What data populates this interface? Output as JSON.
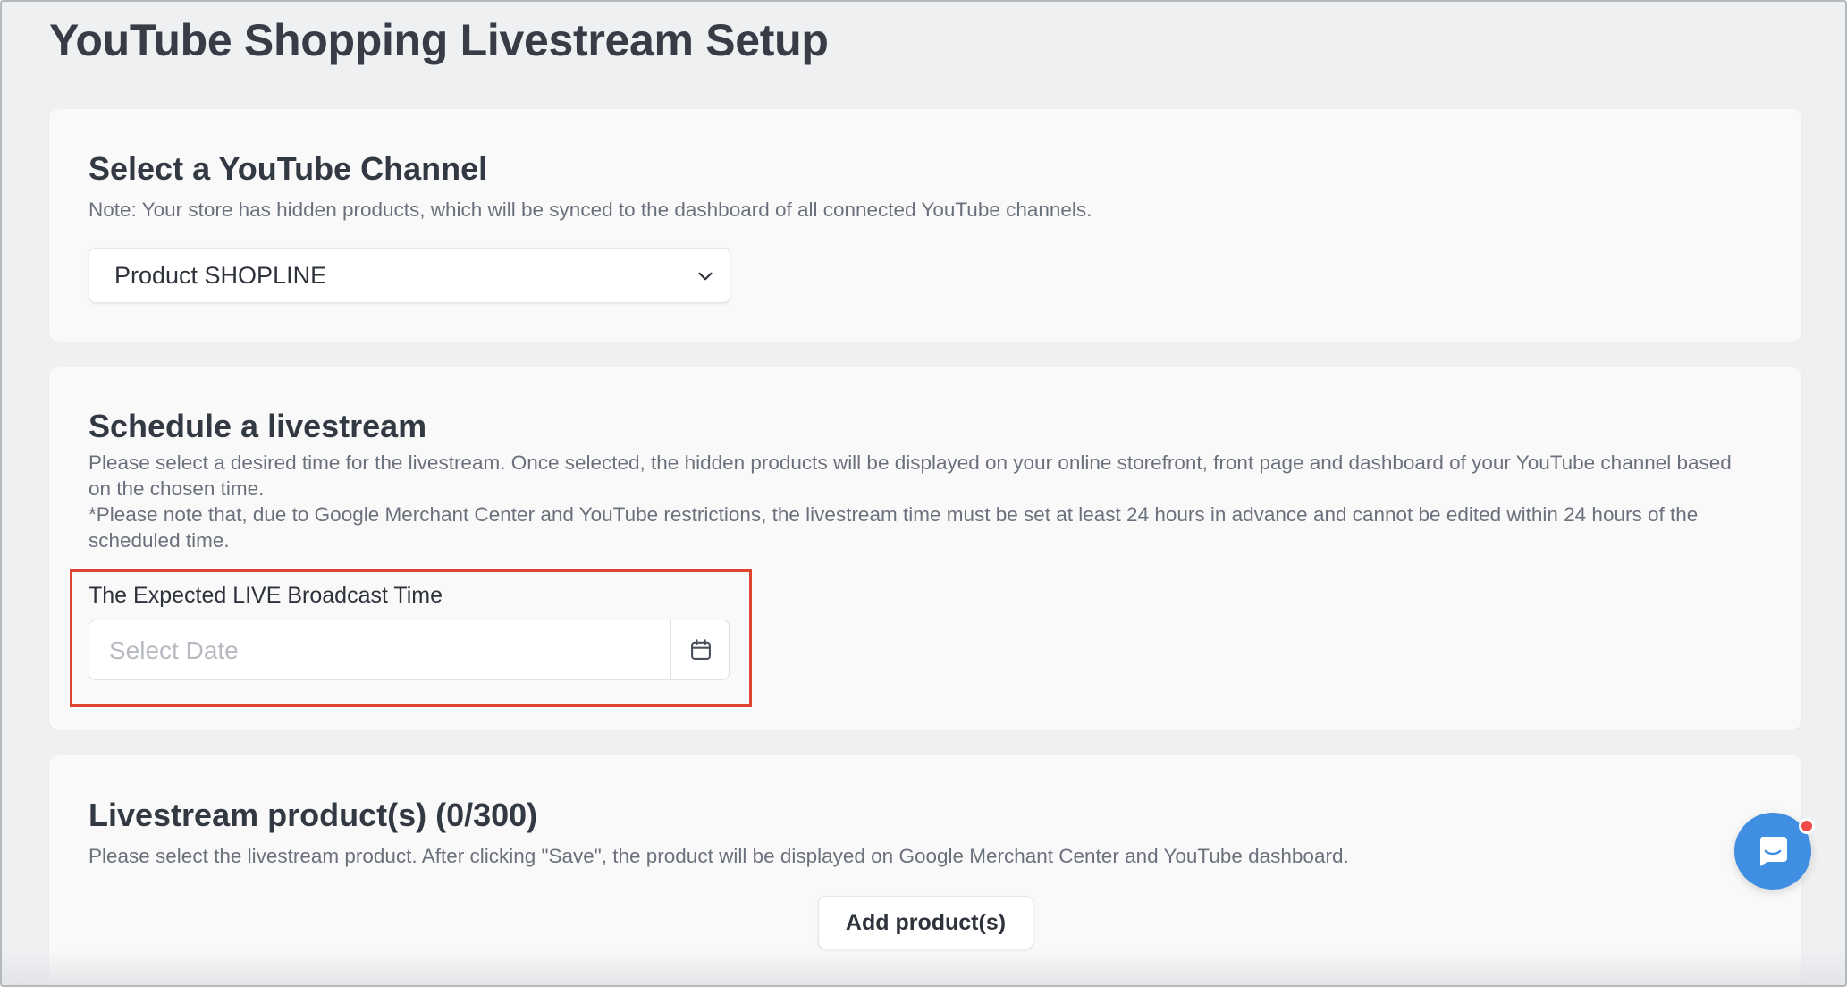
{
  "page": {
    "title": "YouTube Shopping Livestream Setup"
  },
  "channel_section": {
    "title": "Select a YouTube Channel",
    "note": "Note: Your store has hidden products, which will be synced to the dashboard of all connected YouTube channels.",
    "selected_channel": "Product SHOPLINE",
    "select_icon": "chevron-down-icon"
  },
  "schedule_section": {
    "title": "Schedule a livestream",
    "description_1": "Please select a desired time for the livestream. Once selected, the hidden products will be displayed on your online storefront, front page and dashboard of your YouTube channel based on the chosen time.",
    "description_2": "*Please note that, due to Google Merchant Center and YouTube restrictions, the livestream time must be set at least 24 hours in advance and cannot be edited within 24 hours of the scheduled time.",
    "field_label": "The Expected LIVE Broadcast Time",
    "date_placeholder": "Select Date",
    "date_icon": "calendar-icon",
    "highlight_color": "#e0432f"
  },
  "products_section": {
    "title": "Livestream product(s) (0/300)",
    "description": "Please select the livestream product. After clicking \"Save\", the product will be displayed on Google Merchant Center and YouTube dashboard.",
    "add_button_label": "Add product(s)"
  },
  "chat_widget": {
    "icon": "chat-icon",
    "color": "#3f8ee2",
    "notification_color": "#ef4b4b"
  }
}
